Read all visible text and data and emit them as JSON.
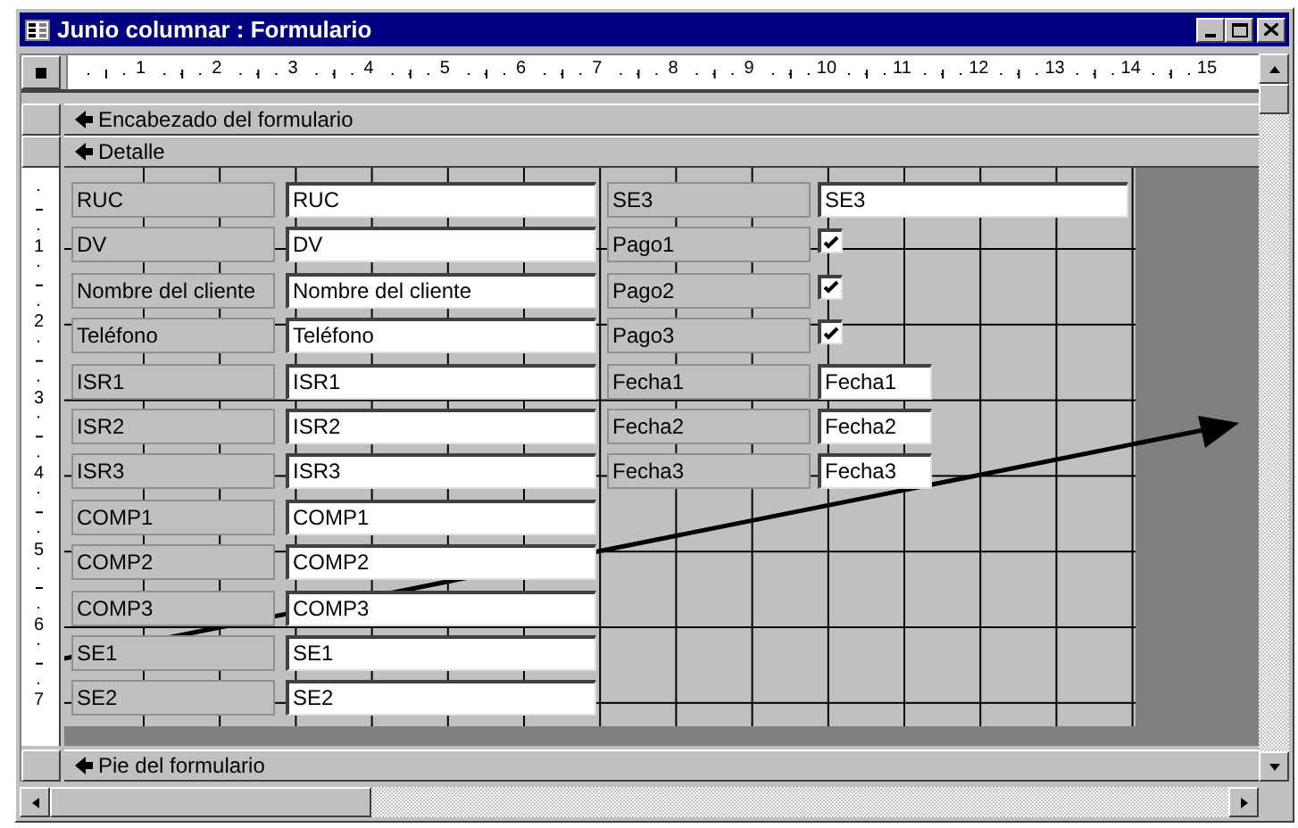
{
  "window": {
    "title": "Junio columnar : Formulario"
  },
  "ruler": {
    "marks": [
      "1",
      "2",
      "3",
      "4",
      "5",
      "6",
      "7",
      "8",
      "9",
      "10",
      "11",
      "12",
      "13",
      "14",
      "15"
    ]
  },
  "vertical_ruler": {
    "marks": [
      "1",
      "2",
      "3",
      "4",
      "5",
      "6",
      "7"
    ]
  },
  "header_sections": [
    {
      "label": "Encabezado del formulario"
    },
    {
      "label": "Detalle"
    }
  ],
  "detail": {
    "left_controls": [
      {
        "kind": "text",
        "label": "RUC",
        "value": "RUC"
      },
      {
        "kind": "text",
        "label": "DV",
        "value": "DV"
      },
      {
        "kind": "text",
        "label": "Nombre del cliente",
        "value": "Nombre del cliente"
      },
      {
        "kind": "text",
        "label": "Teléfono",
        "value": "Teléfono"
      },
      {
        "kind": "text",
        "label": "ISR1",
        "value": "ISR1"
      },
      {
        "kind": "text",
        "label": "ISR2",
        "value": "ISR2"
      },
      {
        "kind": "text",
        "label": "ISR3",
        "value": "ISR3"
      },
      {
        "kind": "text",
        "label": "COMP1",
        "value": "COMP1"
      },
      {
        "kind": "text",
        "label": "COMP2",
        "value": "COMP2"
      },
      {
        "kind": "text",
        "label": "COMP3",
        "value": "COMP3"
      },
      {
        "kind": "text",
        "label": "SE1",
        "value": "SE1"
      },
      {
        "kind": "text",
        "label": "SE2",
        "value": "SE2"
      }
    ],
    "right_controls": [
      {
        "kind": "text",
        "label": "SE3",
        "value": "SE3"
      },
      {
        "kind": "check",
        "label": "Pago1",
        "checked": true
      },
      {
        "kind": "check",
        "label": "Pago2",
        "checked": true
      },
      {
        "kind": "check",
        "label": "Pago3",
        "checked": true
      },
      {
        "kind": "date",
        "label": "Fecha1",
        "value": "Fecha1"
      },
      {
        "kind": "date",
        "label": "Fecha2",
        "value": "Fecha2"
      },
      {
        "kind": "date",
        "label": "Fecha3",
        "value": "Fecha3"
      }
    ]
  },
  "footer_section": {
    "label": "Pie del formulario"
  }
}
